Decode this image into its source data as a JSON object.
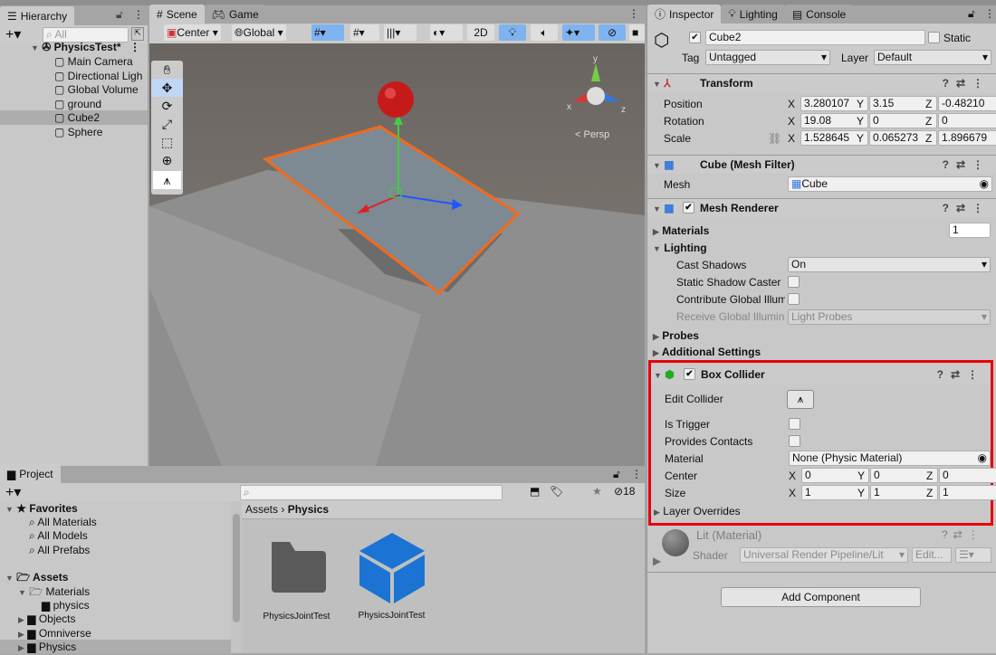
{
  "hierarchy": {
    "tab": "Hierarchy",
    "search_placeholder": "All",
    "scene": "PhysicsTest*",
    "items": [
      "Main Camera",
      "Directional Ligh",
      "Global Volume",
      "ground",
      "Cube2",
      "Sphere"
    ],
    "selected": "Cube2"
  },
  "scene": {
    "tabs": [
      "Scene",
      "Game"
    ],
    "pivot": "Center",
    "space": "Global",
    "mode_2d": "2D",
    "persp": "Persp",
    "gizmo_axes": [
      "y",
      "x",
      "z"
    ]
  },
  "inspector": {
    "tabs": [
      "Inspector",
      "Lighting",
      "Console"
    ],
    "object_name": "Cube2",
    "active": true,
    "static_label": "Static",
    "tag_label": "Tag",
    "tag": "Untagged",
    "layer_label": "Layer",
    "layer": "Default",
    "transform": {
      "title": "Transform",
      "position_label": "Position",
      "rotation_label": "Rotation",
      "scale_label": "Scale",
      "position": [
        "3.280107",
        "3.15",
        "-0.48210"
      ],
      "rotation": [
        "19.08",
        "0",
        "0"
      ],
      "scale": [
        "1.528645",
        "0.065273",
        "1.896679"
      ],
      "axes": [
        "X",
        "Y",
        "Z"
      ]
    },
    "mesh_filter": {
      "title": "Cube (Mesh Filter)",
      "mesh_label": "Mesh",
      "mesh": "Cube"
    },
    "mesh_renderer": {
      "title": "Mesh Renderer",
      "materials_label": "Materials",
      "materials_count": "1",
      "lighting_label": "Lighting",
      "cast_shadows_label": "Cast Shadows",
      "cast_shadows": "On",
      "static_shadow_label": "Static Shadow Caster",
      "contribute_gi_label": "Contribute Global Illum",
      "receive_gi_label": "Receive Global Illumin",
      "receive_gi": "Light Probes",
      "probes_label": "Probes",
      "additional_label": "Additional Settings"
    },
    "box_collider": {
      "title": "Box Collider",
      "edit_collider_label": "Edit Collider",
      "is_trigger_label": "Is Trigger",
      "provides_contacts_label": "Provides Contacts",
      "material_label": "Material",
      "material": "None (Physic Material)",
      "center_label": "Center",
      "center": [
        "0",
        "0",
        "0"
      ],
      "size_label": "Size",
      "size": [
        "1",
        "1",
        "1"
      ],
      "layer_overrides_label": "Layer Overrides",
      "highlight_color": "#e8000b"
    },
    "material": {
      "name": "Lit (Material)",
      "shader_label": "Shader",
      "shader": "Universal Render Pipeline/Lit",
      "edit_label": "Edit..."
    },
    "add_component": "Add Component"
  },
  "project": {
    "tab": "Project",
    "favorites_label": "Favorites",
    "favorites": [
      "All Materials",
      "All Models",
      "All Prefabs"
    ],
    "assets_label": "Assets",
    "tree": [
      {
        "label": "Materials",
        "expanded": true
      },
      {
        "label": "physics",
        "child": true
      },
      {
        "label": "Objects"
      },
      {
        "label": "Omniverse"
      },
      {
        "label": "Physics",
        "selected": true
      }
    ],
    "breadcrumb": [
      "Assets",
      "Physics"
    ],
    "hidden_count": "18",
    "files": [
      {
        "name": "PhysicsJointTest",
        "type": "folder"
      },
      {
        "name": "PhysicsJointTest",
        "type": "prefab"
      }
    ]
  },
  "colors": {
    "accent": "#3a72d8",
    "selection_outline": "#f26a1b",
    "prefab": "#1b74d4"
  }
}
